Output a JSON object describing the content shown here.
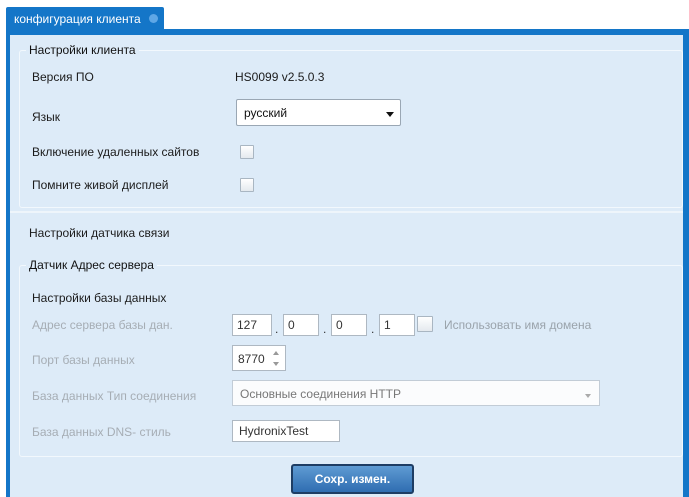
{
  "tab": {
    "label": "конфигурация клиента"
  },
  "client_settings": {
    "title": "Настройки клиента",
    "version_label": "Версия ПО",
    "version_value": "HS0099 v2.5.0.3",
    "language_label": "Язык",
    "language_value": "русский",
    "remote_sites_label": "Включение удаленных сайтов",
    "remote_sites_checked": false,
    "live_display_label": "Помните живой дисплей",
    "live_display_checked": false
  },
  "comm_sensor": {
    "title": "Настройки датчика связи"
  },
  "server_address": {
    "title": "Датчик Адрес сервера"
  },
  "database": {
    "title": "Настройки базы данных",
    "address_label": "Адрес сервера базы дан.",
    "ip": [
      "127",
      "0",
      "0",
      "1"
    ],
    "ip_separator": ".",
    "use_domain_label": "Использовать имя домена",
    "use_domain_checked": false,
    "port_label": "Порт базы данных",
    "port_value": "8770",
    "conn_type_label": "База данных Тип соединения",
    "conn_type_value": "Основные соединения HTTP",
    "dns_label": "База данных DNS- стиль",
    "dns_value": "HydronixTest"
  },
  "save_button": {
    "label": "Сохр. измен."
  }
}
